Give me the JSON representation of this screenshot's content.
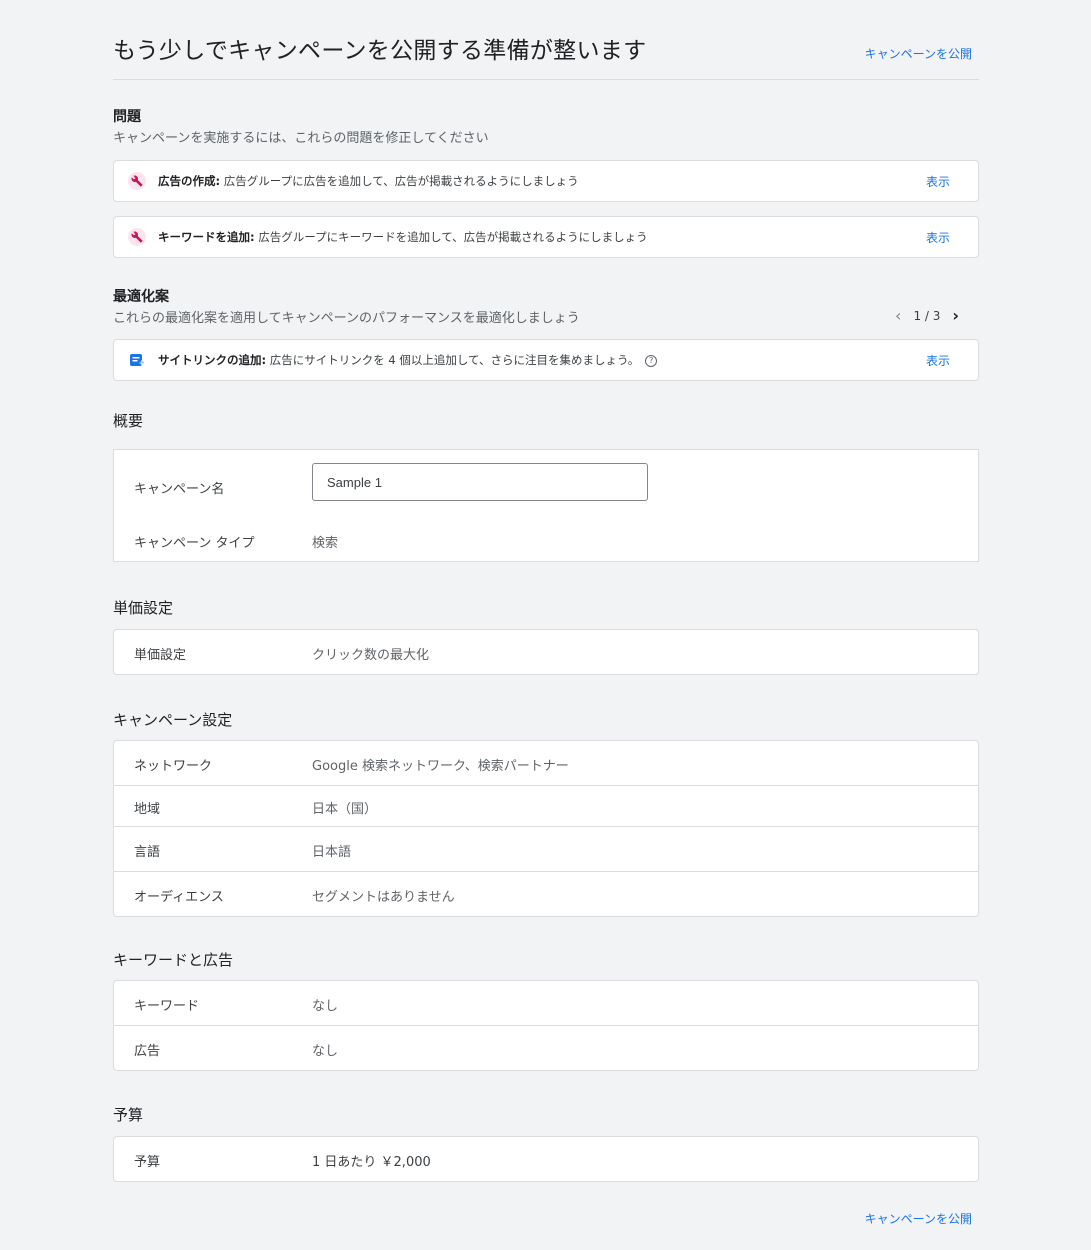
{
  "header": {
    "title": "もう少しでキャンペーンを公開する準備が整います",
    "publish_link": "キャンペーンを公開"
  },
  "issues": {
    "title": "問題",
    "subtitle": "キャンペーンを実施するには、これらの問題を修正してください",
    "items": [
      {
        "bold": "広告の作成:",
        "text": " 広告グループに広告を追加して、広告が掲載されるようにしましょう",
        "action": "表示"
      },
      {
        "bold": "キーワードを追加:",
        "text": " 広告グループにキーワードを追加して、広告が掲載されるようにしましょう",
        "action": "表示"
      }
    ]
  },
  "optimization": {
    "title": "最適化案",
    "subtitle": "これらの最適化案を適用してキャンペーンのパフォーマンスを最適化しましょう",
    "pager": "1 / 3",
    "item": {
      "bold": "サイトリンクの追加:",
      "text": " 広告にサイトリンクを 4 個以上追加して、さらに注目を集めましょう。",
      "action": "表示"
    }
  },
  "overview": {
    "title": "概要",
    "name_label": "キャンペーン名",
    "name_value": "Sample 1",
    "type_label": "キャンペーン タイプ",
    "type_value": "検索"
  },
  "bidding": {
    "title": "単価設定",
    "label": "単価設定",
    "value": "クリック数の最大化"
  },
  "campaign_settings": {
    "title": "キャンペーン設定",
    "rows": [
      {
        "label": "ネットワーク",
        "value": "Google 検索ネットワーク、検索パートナー"
      },
      {
        "label": "地域",
        "value": "日本（国）"
      },
      {
        "label": "言語",
        "value": "日本語"
      },
      {
        "label": "オーディエンス",
        "value": "セグメントはありません"
      }
    ]
  },
  "keywords_ads": {
    "title": "キーワードと広告",
    "rows": [
      {
        "label": "キーワード",
        "value": "なし"
      },
      {
        "label": "広告",
        "value": "なし"
      }
    ]
  },
  "budget": {
    "title": "予算",
    "label": "予算",
    "value": "1 日あたり ￥2,000"
  },
  "footer": {
    "publish_link": "キャンペーンを公開"
  },
  "colors": {
    "link": "#1a73e8",
    "issue_icon": "#c2185b",
    "suggestion_icon": "#1a73e8"
  },
  "icons": {
    "issue": "wrench-icon",
    "suggestion": "sitelink-icon",
    "help": "help-icon"
  }
}
